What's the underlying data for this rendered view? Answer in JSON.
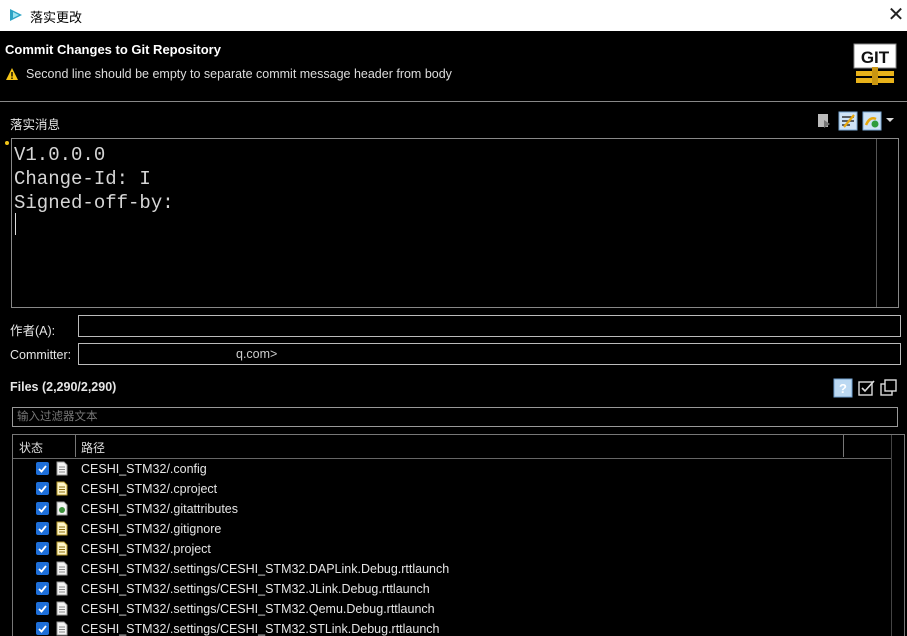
{
  "window": {
    "title": "落实更改"
  },
  "banner": {
    "heading": "Commit Changes to Git Repository",
    "warning": "Second line should be empty to separate commit message header from body"
  },
  "message": {
    "label": "落实消息",
    "lines": [
      "V1.0.0.0",
      "Change-Id: I",
      "Signed-off-by:"
    ],
    "toolbar_icons": [
      "apply-template-icon",
      "add-signed-off-by-icon",
      "add-change-id-icon",
      "dropdown-arrow-icon"
    ]
  },
  "author": {
    "label": "作者(A):",
    "value": ""
  },
  "committer": {
    "label": "Committer:",
    "value": "q.com>"
  },
  "files": {
    "label": "Files (2,290/2,290)",
    "filter_placeholder": "输入过滤器文本",
    "columns": [
      "状态",
      "路径"
    ],
    "rows": [
      {
        "path": "CESHI_STM32/.config",
        "checked": true,
        "icon": "text-file-icon"
      },
      {
        "path": "CESHI_STM32/.cproject",
        "checked": true,
        "icon": "edit-file-icon"
      },
      {
        "path": "CESHI_STM32/.gitattributes",
        "checked": true,
        "icon": "git-file-icon"
      },
      {
        "path": "CESHI_STM32/.gitignore",
        "checked": true,
        "icon": "edit-file-icon"
      },
      {
        "path": "CESHI_STM32/.project",
        "checked": true,
        "icon": "edit-file-icon"
      },
      {
        "path": "CESHI_STM32/.settings/CESHI_STM32.DAPLink.Debug.rttlaunch",
        "checked": true,
        "icon": "text-file-icon"
      },
      {
        "path": "CESHI_STM32/.settings/CESHI_STM32.JLink.Debug.rttlaunch",
        "checked": true,
        "icon": "text-file-icon"
      },
      {
        "path": "CESHI_STM32/.settings/CESHI_STM32.Qemu.Debug.rttlaunch",
        "checked": true,
        "icon": "text-file-icon"
      },
      {
        "path": "CESHI_STM32/.settings/CESHI_STM32.STLink.Debug.rttlaunch",
        "checked": true,
        "icon": "text-file-icon"
      }
    ]
  }
}
